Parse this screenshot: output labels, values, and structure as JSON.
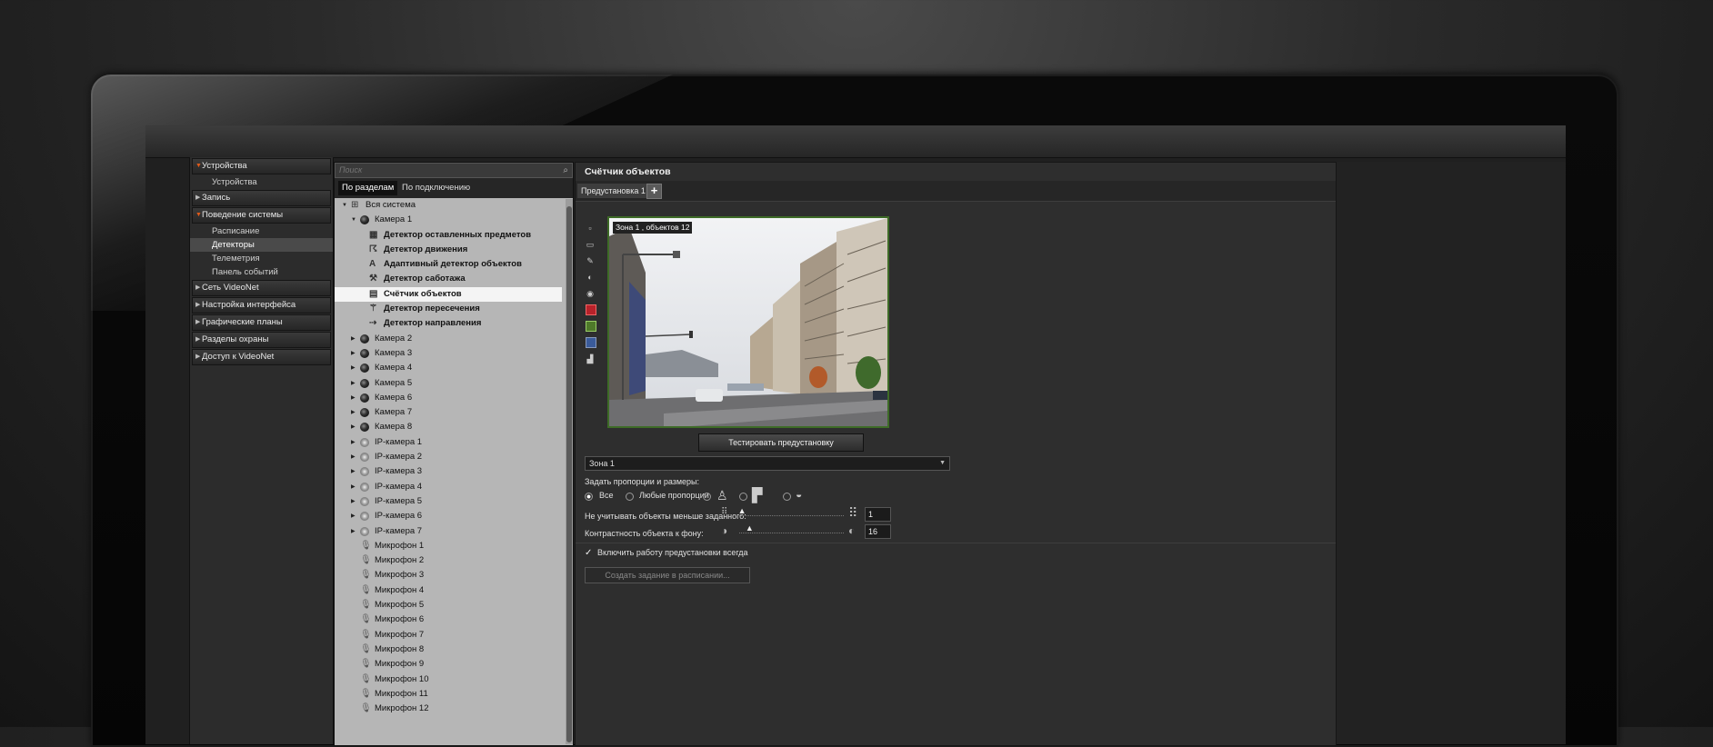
{
  "nav": {
    "sections": [
      {
        "label": "Устройства",
        "open": true,
        "children": [
          "Устройства"
        ]
      },
      {
        "label": "Запись",
        "open": false,
        "children": []
      },
      {
        "label": "Поведение системы",
        "open": true,
        "children": [
          "Расписание",
          "Детекторы",
          "Телеметрия",
          "Панель событий"
        ],
        "selected_child": "Детекторы"
      },
      {
        "label": "Сеть VideoNet",
        "open": false,
        "children": []
      },
      {
        "label": "Настройка интерфейса",
        "open": false,
        "children": []
      },
      {
        "label": "Графические планы",
        "open": false,
        "children": []
      },
      {
        "label": "Разделы охраны",
        "open": false,
        "children": []
      },
      {
        "label": "Доступ к VideoNet",
        "open": false,
        "children": []
      }
    ]
  },
  "tree": {
    "search_placeholder": "Поиск",
    "tabs": [
      "По разделам",
      "По подключению"
    ],
    "active_tab": "По разделам",
    "root": "Вся система",
    "camera1": "Камера 1",
    "detectors": [
      "Детектор оставленных предметов",
      "Детектор движения",
      "Адаптивный детектор объектов",
      "Детектор саботажа",
      "Счётчик объектов",
      "Детектор пересечения",
      "Детектор направления"
    ],
    "selected_detector": "Счётчик объектов",
    "cameras": [
      "Камера 2",
      "Камера 3",
      "Камера 4",
      "Камера 5",
      "Камера 6",
      "Камера 7",
      "Камера 8"
    ],
    "ip_cameras": [
      "IP-камера 1",
      "IP-камера 2",
      "IP-камера 3",
      "IP-камера 4",
      "IP-камера 5",
      "IP-камера 6",
      "IP-камера 7"
    ],
    "microphones": [
      "Микрофон 1",
      "Микрофон 2",
      "Микрофон 3",
      "Микрофон 4",
      "Микрофон 5",
      "Микрофон 6",
      "Микрофон 7",
      "Микрофон 8",
      "Микрофон 9",
      "Микрофон 10",
      "Микрофон 11",
      "Микрофон 12"
    ]
  },
  "detector": {
    "title": "Счётчик объектов",
    "preset_tab": "Предустановка 1",
    "add_preset": "+",
    "zone_overlay": "Зона 1 , объектов 12",
    "zone_corner": "1",
    "test_button": "Тестировать предустановку",
    "zone_select": "Зона 1",
    "proportions_label": "Задать пропорции и размеры:",
    "radio_all": "Все",
    "radio_any": "Любые пропорции",
    "min_size_label": "Не учитывать объекты меньше заданного:",
    "min_size_value": "1",
    "min_size_level": 0.03,
    "contrast_label": "Контрастность объекта к фону:",
    "contrast_value": "16",
    "contrast_level": 0.06,
    "always_on_label": "Включить работу предустановки всегда",
    "always_on_checked": true,
    "schedule_button": "Создать задание в расписании..."
  },
  "colors": {
    "accent_orange": "#e05a1a",
    "zone_border": "#3e6b27"
  }
}
